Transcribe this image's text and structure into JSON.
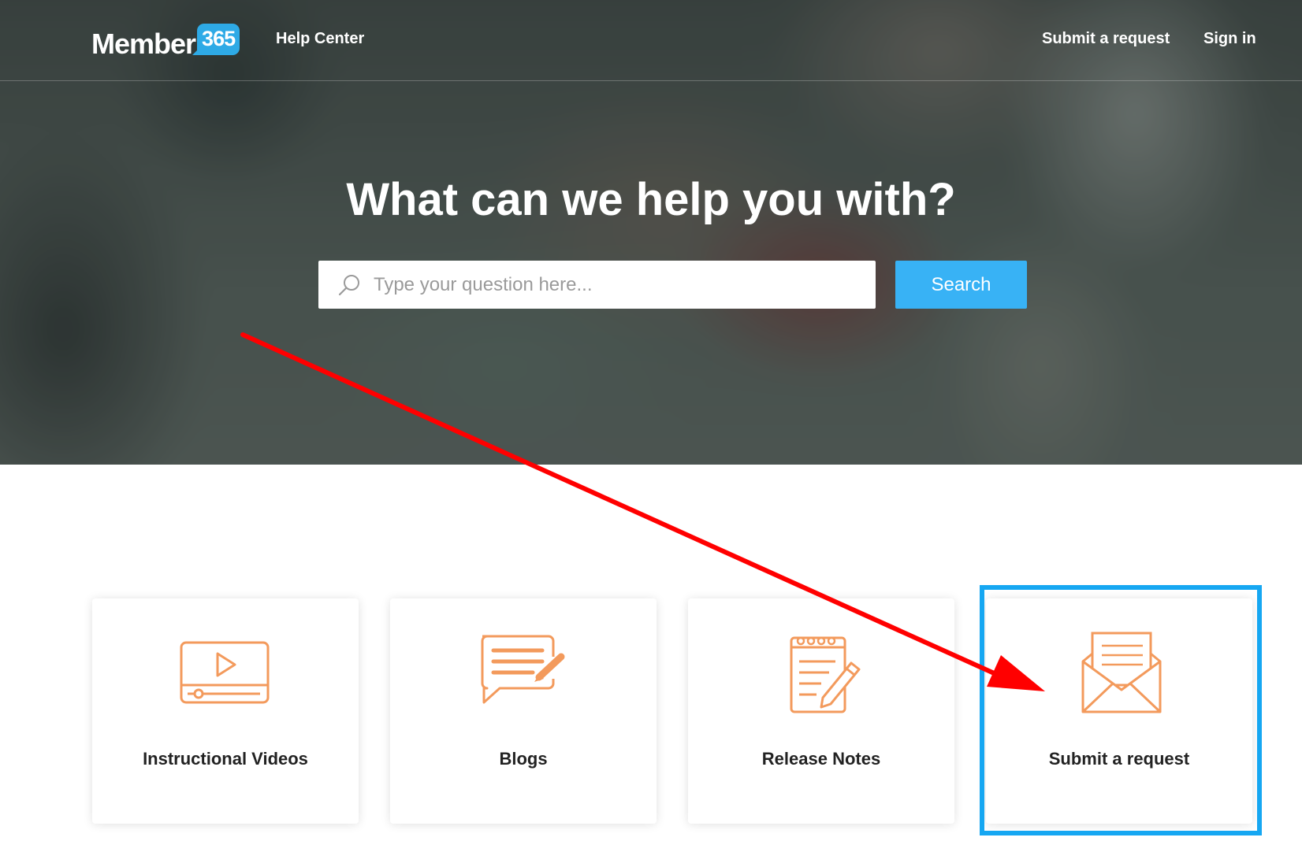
{
  "header": {
    "logo_word": "Member",
    "logo_badge": "365",
    "help_center": "Help Center",
    "nav": {
      "submit_request": "Submit a request",
      "sign_in": "Sign in"
    }
  },
  "hero": {
    "title": "What can we help you with?",
    "search": {
      "placeholder": "Type your question here...",
      "value": "",
      "button_label": "Search"
    }
  },
  "cards": [
    {
      "label": "Instructional Videos",
      "icon": "video-player-icon"
    },
    {
      "label": "Blogs",
      "icon": "chat-edit-icon"
    },
    {
      "label": "Release Notes",
      "icon": "notepad-pen-icon"
    },
    {
      "label": "Submit a request",
      "icon": "envelope-letter-icon"
    }
  ],
  "colors": {
    "accent_blue": "#38b2f5",
    "icon_orange": "#f39a5c",
    "highlight_blue": "#16a7f2",
    "annotation_red": "#ff0000"
  }
}
